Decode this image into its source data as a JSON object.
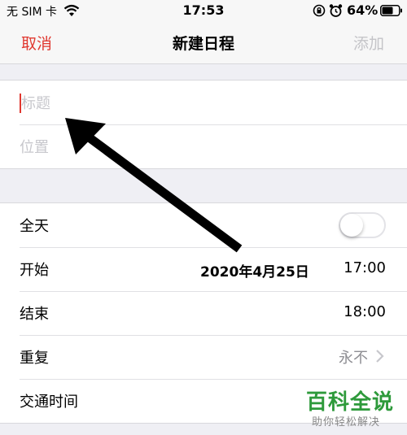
{
  "status_bar": {
    "carrier": "无 SIM 卡",
    "time": "17:53",
    "battery_percent": "64%",
    "icons": [
      "wifi-icon",
      "orientation-lock-icon",
      "alarm-icon",
      "battery-icon"
    ]
  },
  "nav": {
    "cancel_label": "取消",
    "title": "新建日程",
    "add_label": "添加"
  },
  "form": {
    "title_placeholder": "标题",
    "location_placeholder": "位置",
    "all_day_label": "全天",
    "all_day_on": false,
    "start_label": "开始",
    "start_date": "2020年4月25日",
    "start_time": "17:00",
    "end_label": "结束",
    "end_time": "18:00",
    "repeat_label": "重复",
    "repeat_value": "永不",
    "travel_label": "交通时间"
  },
  "watermark": {
    "line1": "百科全说",
    "line2": "助你轻松解决"
  },
  "colors": {
    "accent": "#e0372f",
    "disabled": "#c4c4c8",
    "background": "#efeff4",
    "watermark_green": "#2e9a3b"
  }
}
